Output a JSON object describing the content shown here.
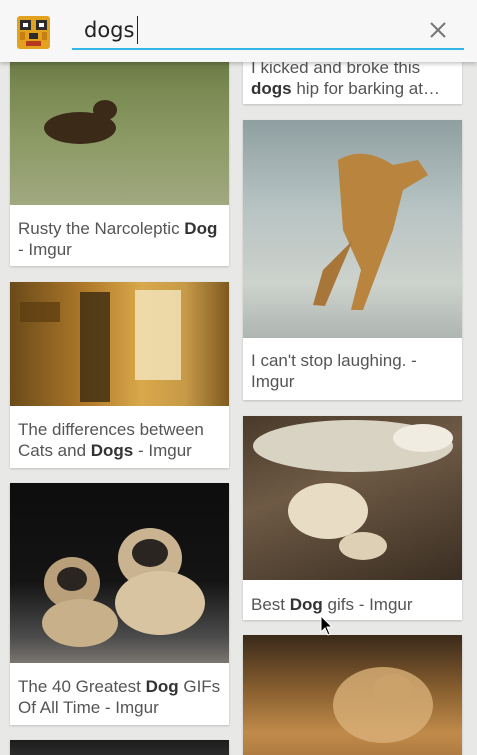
{
  "search": {
    "query": "dogs",
    "clear_icon": "close-icon",
    "app_icon": "app-logo-icon"
  },
  "results": {
    "left": [
      {
        "caption_pre": "Rusty the Narcoleptic ",
        "caption_bold": "Dog",
        "caption_post": " - Imgur",
        "thumb_icon": "dog-image"
      },
      {
        "caption_pre": "The differences between Cats and ",
        "caption_bold": "Dogs",
        "caption_post": " - Imgur",
        "thumb_icon": "dog-image"
      },
      {
        "caption_pre": "The 40 Greatest ",
        "caption_bold": "Dog",
        "caption_post": " GIFs Of All Time - Imgur",
        "thumb_icon": "pug-image"
      }
    ],
    "right": [
      {
        "caption_pre": "I kicked and broke this ",
        "caption_bold": "dogs",
        "caption_post": " hip for barking at…",
        "thumb_icon": "dog-image"
      },
      {
        "caption_pre": "I can't stop laughing. - Imgur",
        "caption_bold": "",
        "caption_post": "",
        "thumb_icon": "dog-image"
      },
      {
        "caption_pre": "Best ",
        "caption_bold": "Dog",
        "caption_post": " gifs - Imgur",
        "thumb_icon": "dog-image"
      }
    ]
  },
  "colors": {
    "accent": "#33b5e5",
    "background": "#e8e8e6",
    "card": "#ffffff"
  }
}
